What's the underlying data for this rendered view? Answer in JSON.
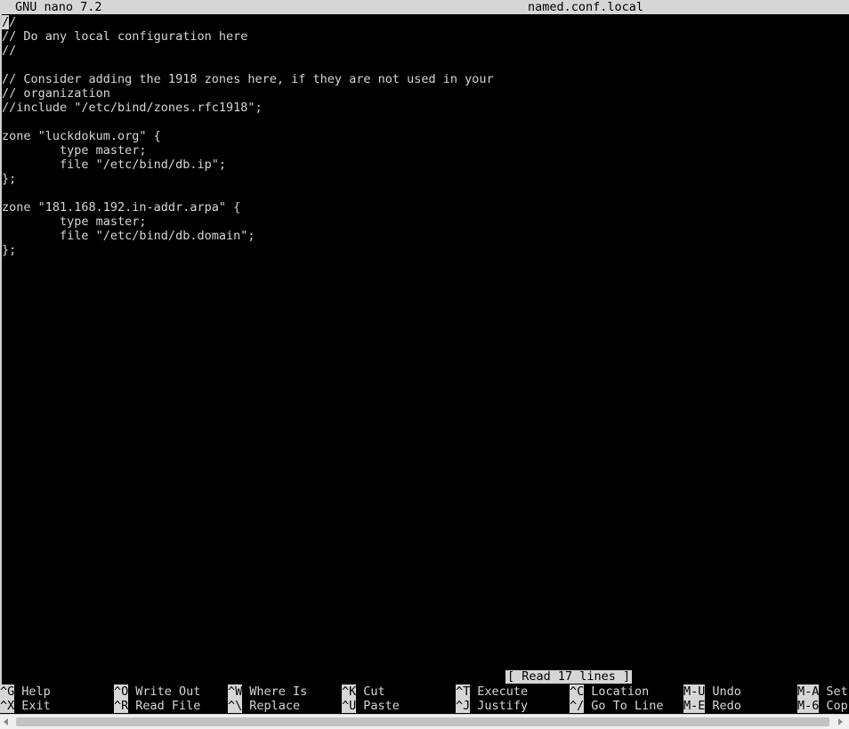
{
  "titlebar": {
    "app": "GNU nano 7.2",
    "filename": "named.conf.local"
  },
  "editor": {
    "lines": [
      "//",
      "// Do any local configuration here",
      "//",
      "",
      "// Consider adding the 1918 zones here, if they are not used in your",
      "// organization",
      "//include \"/etc/bind/zones.rfc1918\";",
      "",
      "zone \"luckdokum.org\" {",
      "        type master;",
      "        file \"/etc/bind/db.ip\";",
      "};",
      "",
      "zone \"181.168.192.in-addr.arpa\" {",
      "        type master;",
      "        file \"/etc/bind/db.domain\";",
      "};"
    ]
  },
  "status": "[ Read 17 lines ]",
  "shortcuts": {
    "row1": [
      {
        "key": "^G",
        "label": "Help"
      },
      {
        "key": "^O",
        "label": "Write Out"
      },
      {
        "key": "^W",
        "label": "Where Is"
      },
      {
        "key": "^K",
        "label": "Cut"
      },
      {
        "key": "^T",
        "label": "Execute"
      },
      {
        "key": "^C",
        "label": "Location"
      },
      {
        "key": "M-U",
        "label": "Undo"
      },
      {
        "key": "M-A",
        "label": "Set"
      }
    ],
    "row2": [
      {
        "key": "^X",
        "label": "Exit"
      },
      {
        "key": "^R",
        "label": "Read File"
      },
      {
        "key": "^\\",
        "label": "Replace"
      },
      {
        "key": "^U",
        "label": "Paste"
      },
      {
        "key": "^J",
        "label": "Justify"
      },
      {
        "key": "^/",
        "label": "Go To Line"
      },
      {
        "key": "M-E",
        "label": "Redo"
      },
      {
        "key": "M-6",
        "label": "Cop"
      }
    ]
  },
  "colors": {
    "background": "#000000",
    "foreground": "#d6d6d6",
    "inverse_bg": "#d6d6d6",
    "inverse_fg": "#000000"
  }
}
